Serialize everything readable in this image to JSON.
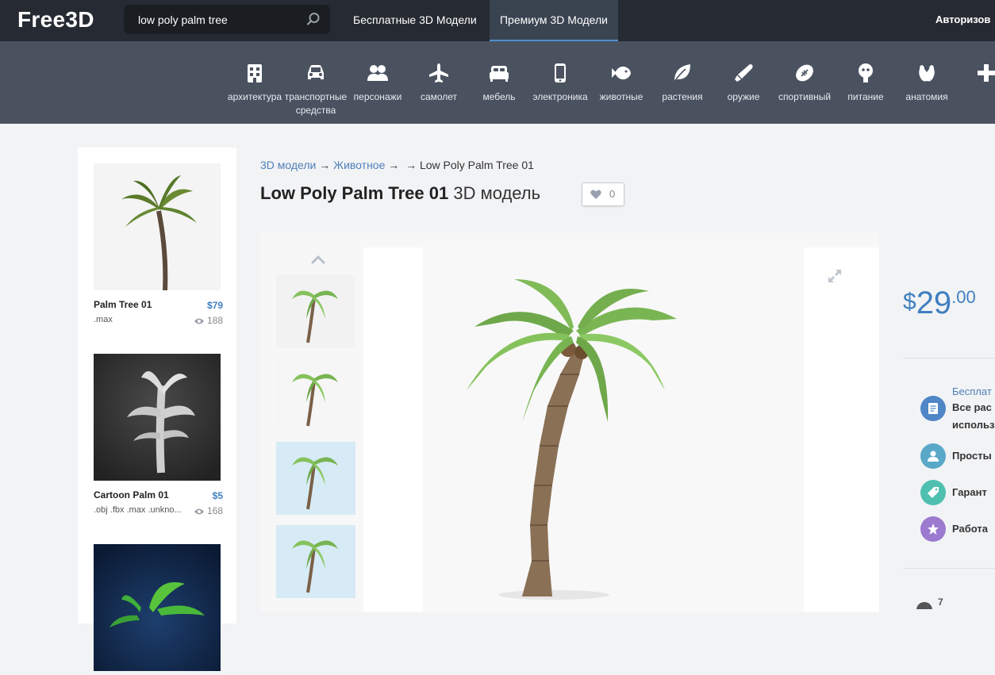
{
  "header": {
    "logo": "Free3D",
    "search": {
      "value": "low poly palm tree"
    },
    "nav": {
      "free": "Бесплатные 3D Модели",
      "premium": "Премиум 3D Модели",
      "login": "Авторизов"
    }
  },
  "categories": [
    {
      "label": "архитектура",
      "icon": "building-icon"
    },
    {
      "label": "транспортные средства",
      "icon": "car-icon"
    },
    {
      "label": "персонажи",
      "icon": "people-icon"
    },
    {
      "label": "самолет",
      "icon": "airplane-icon"
    },
    {
      "label": "мебель",
      "icon": "bed-icon"
    },
    {
      "label": "электроника",
      "icon": "phone-icon"
    },
    {
      "label": "животные",
      "icon": "fish-icon"
    },
    {
      "label": "растения",
      "icon": "leaf-icon"
    },
    {
      "label": "оружие",
      "icon": "weapon-icon"
    },
    {
      "label": "спортивный",
      "icon": "football-icon"
    },
    {
      "label": "питание",
      "icon": "food-icon"
    },
    {
      "label": "анатомия",
      "icon": "anatomy-icon"
    },
    {
      "label": "",
      "icon": "plus-icon"
    }
  ],
  "sidebar": {
    "items": [
      {
        "title": "Palm Tree 01",
        "price": "$79",
        "formats": ".max",
        "views": "188"
      },
      {
        "title": "Cartoon Palm 01",
        "price": "$5",
        "formats": ".obj .fbx .max .unkno...",
        "views": "168"
      },
      {
        "title": "",
        "price": "",
        "formats": "",
        "views": ""
      }
    ]
  },
  "breadcrumb": {
    "root": "3D модели",
    "category": "Животное",
    "arrow": "→",
    "current": "Low Poly Palm Tree 01"
  },
  "product": {
    "title": "Low Poly Palm Tree 01",
    "subtitle": "3D модель",
    "likes": "0",
    "price": {
      "currency": "$",
      "whole": "29",
      "cents": ".00"
    }
  },
  "features": {
    "free_label": "Бесплат",
    "items": [
      {
        "text": "Все рас",
        "text2": "использ",
        "icon": "document-icon",
        "color": "#4f86c6"
      },
      {
        "text": "Просты",
        "icon": "user-icon",
        "color": "#5aa8c8"
      },
      {
        "text": "Гарант",
        "icon": "tag-icon",
        "color": "#4fbfb0"
      },
      {
        "text": "Работа",
        "icon": "star-icon",
        "color": "#9b7ad0"
      }
    ]
  },
  "bottom_count": "7",
  "colors": {
    "accent": "#3f7fc1",
    "topbar": "#262b33",
    "catbar": "#4a5260"
  }
}
